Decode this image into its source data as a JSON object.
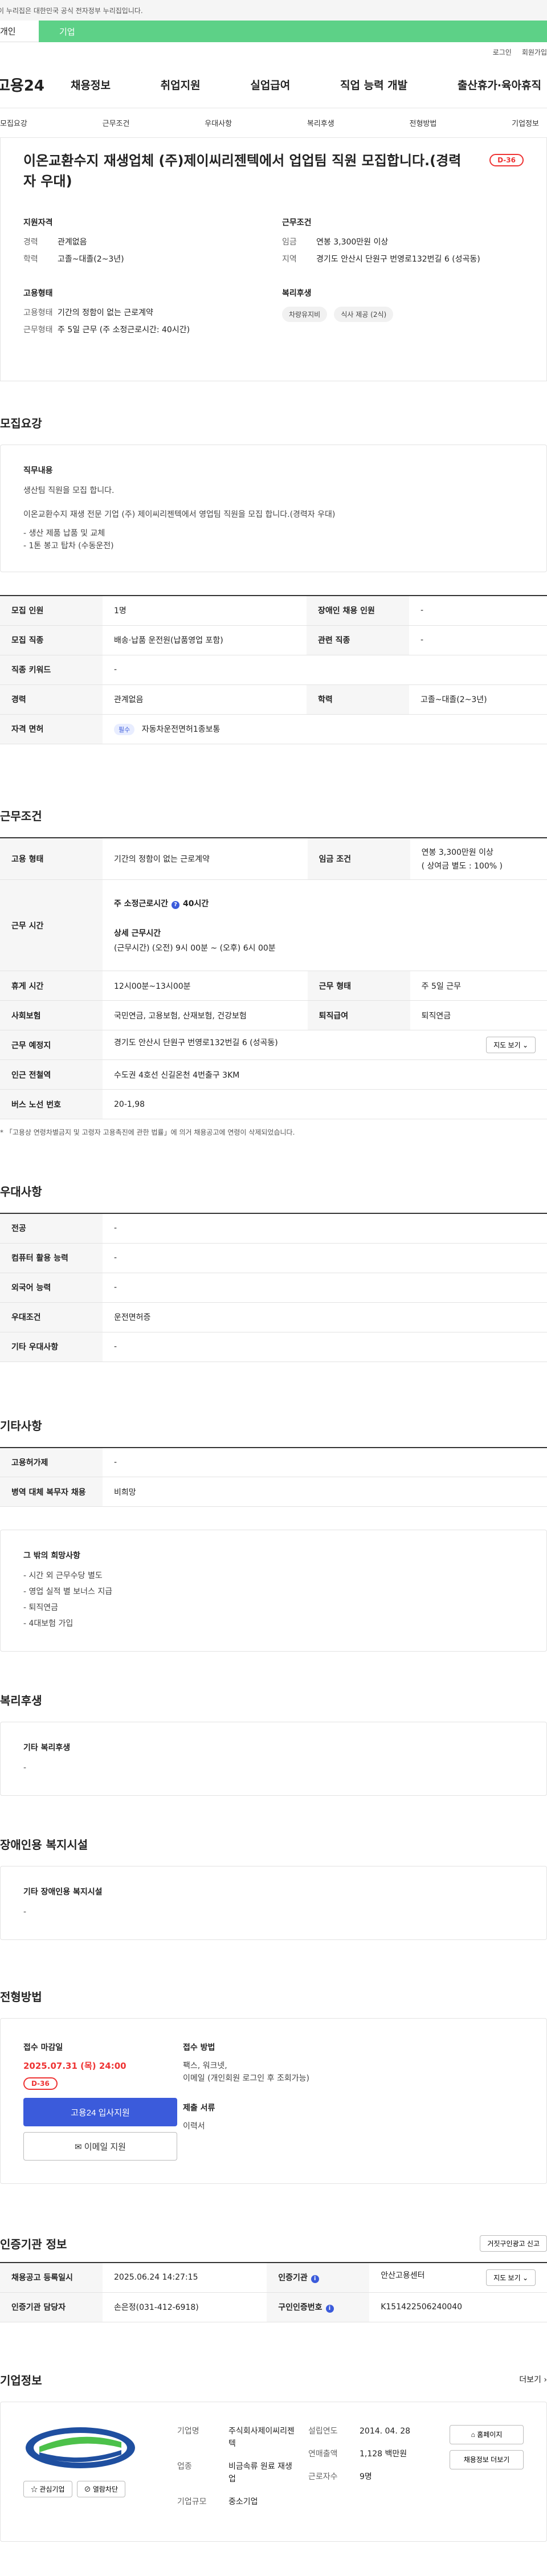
{
  "gov_bar": "이 누리집은 대한민국 공식 전자정부 누리집입니다.",
  "tabs": {
    "person": "개인",
    "company": "기업"
  },
  "util": {
    "login": "로그인",
    "signup": "회원가입"
  },
  "logo": "고용24",
  "gnb": [
    "채용정보",
    "취업지원",
    "실업급여",
    "직업 능력 개발",
    "출산휴가·육아휴직"
  ],
  "anchors": [
    "모집요강",
    "근무조건",
    "우대사항",
    "복리후생",
    "전형방법",
    "기업정보"
  ],
  "summary": {
    "title": "이온교환수지 재생업체 (주)제이씨리젠텍에서 업업팀 직원 모집합니다.(경력자 우대)",
    "dday": "D-36",
    "qual": {
      "title": "지원자격",
      "career_k": "경력",
      "career_v": "관계없음",
      "edu_k": "학력",
      "edu_v": "고졸~대졸(2~3년)"
    },
    "cond": {
      "title": "근무조건",
      "wage_k": "임금",
      "wage_v": "연봉 3,300만원 이상",
      "area_k": "지역",
      "area_v": "경기도 안산시 단원구 번영로132번길 6 (성곡동)"
    },
    "emp": {
      "title": "고용형태",
      "type_k": "고용형태",
      "type_v": "기간의 정함이 없는 근로계약",
      "work_k": "근무형태",
      "work_v": "주 5일 근무 (주 소정근로시간: 40시간)"
    },
    "welfare": {
      "title": "복리후생",
      "chip1": "차량유지비",
      "chip2": "식사 제공 (2식)"
    }
  },
  "recruit": {
    "section": "모집요강",
    "duty_title": "직무내용",
    "duty_line1": "생산팀 직원을 모집 합니다.",
    "duty_line2": "이온교환수지 재생 전문 기업 (주) 제이씨리젠텍에서 영업팀 직원을 모집 합니다.(경력자 우대)",
    "duty_li1": "-  생산 제품 납품 및 교체",
    "duty_li2": "-  1톤 봉고 탑차 (수동운전)",
    "rows": {
      "count_k": "모집 인원",
      "count_v": "1명",
      "disabled_k": "장애인 채용 인원",
      "disabled_v": "-",
      "job_k": "모집 직종",
      "job_v": "배송·납품 운전원(납품영업 포함)",
      "rel_k": "관련 직종",
      "rel_v": "-",
      "kw_k": "직종 키워드",
      "kw_v": "-",
      "career_k": "경력",
      "career_v": "관계없음",
      "edu_k": "학력",
      "edu_v": "고졸~대졸(2~3년)",
      "lic_k": "자격 면허",
      "lic_badge": "필수",
      "lic_v": "자동차운전면허1종보통"
    }
  },
  "work": {
    "section": "근무조건",
    "type_k": "고용 형태",
    "type_v": "기간의 정함이 없는 근로계약",
    "wage_k": "임금 조건",
    "wage_v1": "연봉 3,300만원 이상",
    "wage_v2": "( 상여금 별도 : 100% )",
    "time_k": "근무 시간",
    "time_head": "주 소정근로시간",
    "time_q": "?",
    "time_hours": "40시간",
    "time_detail_title": "상세 근무시간",
    "time_detail": "(근무시간) (오전) 9시 00분 ~ (오후) 6시 00분",
    "break_k": "휴게 시간",
    "break_v": "12시00분~13시00분",
    "form_k": "근무 형태",
    "form_v": "주 5일 근무",
    "ins_k": "사회보험",
    "ins_v": "국민연금, 고용보험, 산재보험, 건강보험",
    "ret_k": "퇴직급여",
    "ret_v": "퇴직연금",
    "place_k": "근무 예정지",
    "place_v": "경기도 안산시 단원구 번영로132번길 6 (성곡동)",
    "map_btn": "지도 보기 ⌄",
    "sub_k": "인근 전철역",
    "sub_v": "수도권 4호선 신길온천 4번출구 3KM",
    "bus_k": "버스 노선 번호",
    "bus_v": "20-1,98",
    "note": "* 「고용상 연령차별금지 및 고령자 고용촉진에 관한 법률」에 의거 채용공고에 연령이 삭제되었습니다."
  },
  "pref": {
    "section": "우대사항",
    "major_k": "전공",
    "major_v": "-",
    "pc_k": "컴퓨터 활용 능력",
    "pc_v": "-",
    "lang_k": "외국어 능력",
    "lang_v": "-",
    "cond_k": "우대조건",
    "cond_v": "운전면허증",
    "etc_k": "기타 우대사항",
    "etc_v": "-"
  },
  "other": {
    "section": "기타사항",
    "ins_k": "고용허가제",
    "ins_v": "-",
    "mil_k": "병역 대체 복무자 채용",
    "mil_v": "비희망",
    "box_title": "그 밖의 희망사항",
    "li1": "- 시간 외 근무수당 별도",
    "li2": "- 영업 실적 별 보너스 지급",
    "li3": "- 퇴직연금",
    "li4": "- 4대보험 가입"
  },
  "welfare": {
    "section": "복리후생",
    "box_title": "기타 복리후생",
    "v": "-"
  },
  "disability": {
    "section": "장애인용 복지시설",
    "box_title": "기타 장애인용 복지시설",
    "v": "-"
  },
  "apply": {
    "section": "전형방법",
    "deadline_title": "접수 마감일",
    "deadline": "2025.07.31 (목) 24:00",
    "dday": "D-36",
    "apply_btn": "고용24 입사지원",
    "email_btn": "✉ 이메일 지원",
    "method_title": "접수 방법",
    "method_v": "팩스, 워크넷,",
    "method_v2": "이메일 (개인회원 로그인 후 조회가능)",
    "doc_title": "제출 서류",
    "doc_v": "이력서"
  },
  "cert": {
    "section": "인증기관 정보",
    "report_btn": "거짓구인광고 신고",
    "date_k": "채용공고 등록일시",
    "date_v": "2025.06.24 14:27:15",
    "org_k": "인증기관",
    "org_v": "안산고용센터",
    "map_btn": "지도 보기 ⌄",
    "staff_k": "인증기관 담당자",
    "staff_v": "손은정(031-412-6918)",
    "no_k": "구인인증번호",
    "no_v": "K151422506240040"
  },
  "company": {
    "section": "기업정보",
    "more": "더보기 ›",
    "fav_btn": "☆ 관심기업",
    "block_btn": "⊘ 열람차단",
    "name_k": "기업명",
    "name_v": "주식회사제이씨리젠텍",
    "ind_k": "업종",
    "ind_v": "비금속류 원료 재생업",
    "size_k": "기업규모",
    "size_v": "중소기업",
    "est_k": "설립연도",
    "est_v": "2014. 04. 28",
    "sales_k": "연매출액",
    "sales_v": "1,128 백만원",
    "emp_k": "근로자수",
    "emp_v": "9명",
    "home_btn": "⌂ 홈페이지",
    "jobs_btn": "채용정보 더보기",
    "colors": {
      "logo_blue": "#1f4fa0",
      "logo_green": "#4cc14a"
    }
  }
}
